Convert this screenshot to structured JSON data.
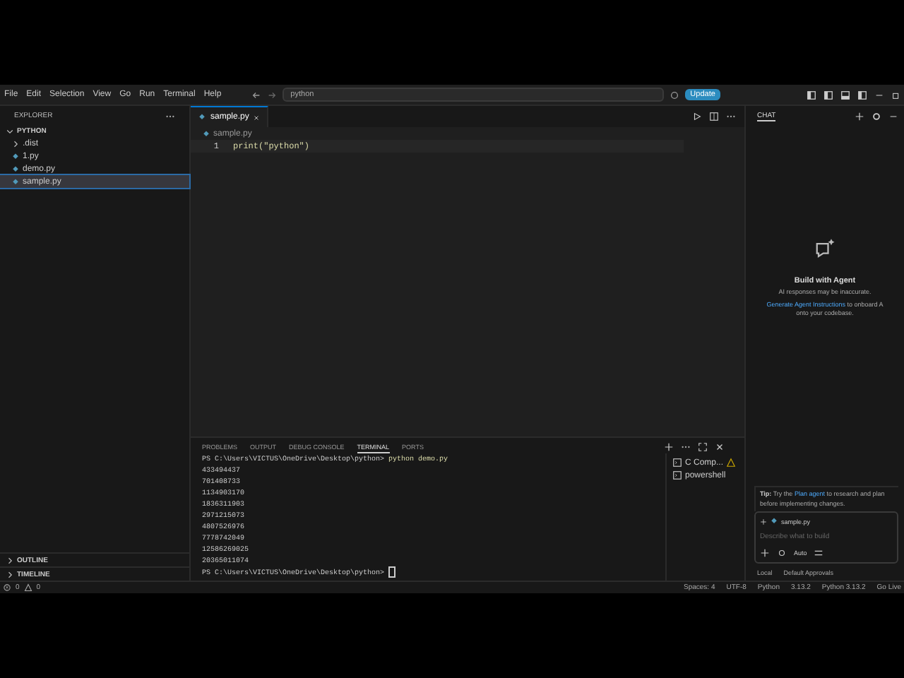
{
  "menu": [
    "File",
    "Edit",
    "Selection",
    "View",
    "Go",
    "Run",
    "Terminal",
    "Help"
  ],
  "search": {
    "value": "python"
  },
  "update_button": "Update",
  "sidebar": {
    "title": "EXPLORER",
    "folder": {
      "label": "PYTHON",
      "expanded": true
    },
    "items": [
      {
        "label": ".dist",
        "kind": "folder",
        "expanded": false,
        "selected": false
      },
      {
        "label": "1.py",
        "kind": "file",
        "selected": false
      },
      {
        "label": "demo.py",
        "kind": "file",
        "selected": false
      },
      {
        "label": "sample.py",
        "kind": "file",
        "selected": true
      }
    ],
    "sections": [
      {
        "label": "OUTLINE",
        "expanded": false
      },
      {
        "label": "TIMELINE",
        "expanded": false
      }
    ]
  },
  "editor": {
    "tabs": [
      {
        "label": "sample.py",
        "selected": true
      }
    ],
    "breadcrumb": "sample.py",
    "lines": [
      {
        "number": "1",
        "code": "print(\"python\")"
      }
    ]
  },
  "panel": {
    "tabs": [
      {
        "label": "PROBLEMS",
        "selected": false
      },
      {
        "label": "OUTPUT",
        "selected": false
      },
      {
        "label": "DEBUG CONSOLE",
        "selected": false
      },
      {
        "label": "TERMINAL",
        "selected": true
      },
      {
        "label": "PORTS",
        "selected": false
      }
    ],
    "prompt": "PS C:\\Users\\VICTUS\\OneDrive\\Desktop\\python>",
    "command": "python demo.py",
    "output": [
      "433494437",
      "701408733",
      "1134903170",
      "1836311903",
      "2971215073",
      "4807526976",
      "7778742049",
      "12586269025",
      "20365011074"
    ],
    "final_prompt": "PS C:\\Users\\VICTUS\\OneDrive\\Desktop\\python>",
    "terminals": [
      {
        "label": "C Comp...",
        "warning": true
      },
      {
        "label": "powershell",
        "warning": false
      }
    ]
  },
  "chat": {
    "title": "CHAT",
    "heading": "Build with Agent",
    "notice": "AI responses may be inaccurate.",
    "instructions_link": "Generate Agent Instructions",
    "instructions_text": "to onboard A",
    "instructions_rest": "onto your codebase.",
    "tip_label": "Tip:",
    "tip_text": "Try the",
    "tip_link": "Plan agent",
    "tip_rest": "to research and plan before implementing changes.",
    "attachment": "sample.py",
    "placeholder": "Describe what to build",
    "mode": "Auto",
    "location": "Local",
    "approvals": "Default Approvals"
  },
  "status_bar": {
    "errors": "0",
    "warnings": "0",
    "items": [
      "Spaces: 4",
      "UTF-8",
      "Python",
      "3.13.2",
      "Python 3.13.2",
      "Go Live"
    ]
  }
}
